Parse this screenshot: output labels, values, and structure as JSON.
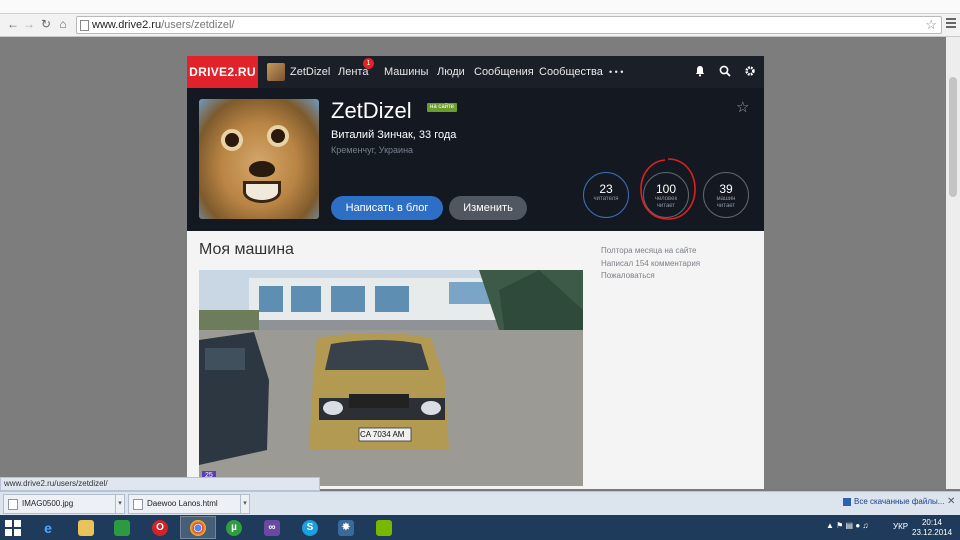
{
  "browser": {
    "url_host": "www.drive2.ru",
    "url_path": "/users/zetdizel/"
  },
  "site": {
    "logo": "DRIVE2.RU",
    "nav": {
      "user": "ZetDizel",
      "items": [
        "Лента",
        "Машины",
        "Люди",
        "Сообщения",
        "Сообщества"
      ],
      "feed_badge": "1",
      "more": "• • •"
    },
    "profile": {
      "name": "ZetDizel",
      "online_badge": "на сайте",
      "fullname": "Виталий Зинчак, 33 года",
      "location": "Кременчуг, Украина",
      "blog_button": "Написать в блог",
      "edit_button": "Изменить",
      "stats": [
        {
          "num": "23",
          "label1": "читателя",
          "label2": ""
        },
        {
          "num": "100",
          "label1": "человек",
          "label2": "читает"
        },
        {
          "num": "39",
          "label1": "машин",
          "label2": "читает"
        }
      ]
    },
    "content": {
      "section_title": "Моя машина",
      "side_links": [
        "Полтора месяца на сайте",
        "Написал 154 комментария",
        "Пожаловаться"
      ],
      "photo_count": "25",
      "plate": "CA 7034 AM"
    }
  },
  "status_url": "www.drive2.ru/users/zetdizel/",
  "downloads": {
    "items": [
      "IMAG0500.jpg",
      "Daewoo Lanos.html"
    ],
    "all_link": "Все скачанные файлы..."
  },
  "taskbar": {
    "lang": "УКР",
    "time": "20:14",
    "date": "23.12.2014"
  },
  "colors": {
    "logo_red": "#e0232b",
    "nav_bg": "#1b1f27",
    "blog_button": "#2e6fc6",
    "highlight_circle": "#e02020"
  }
}
